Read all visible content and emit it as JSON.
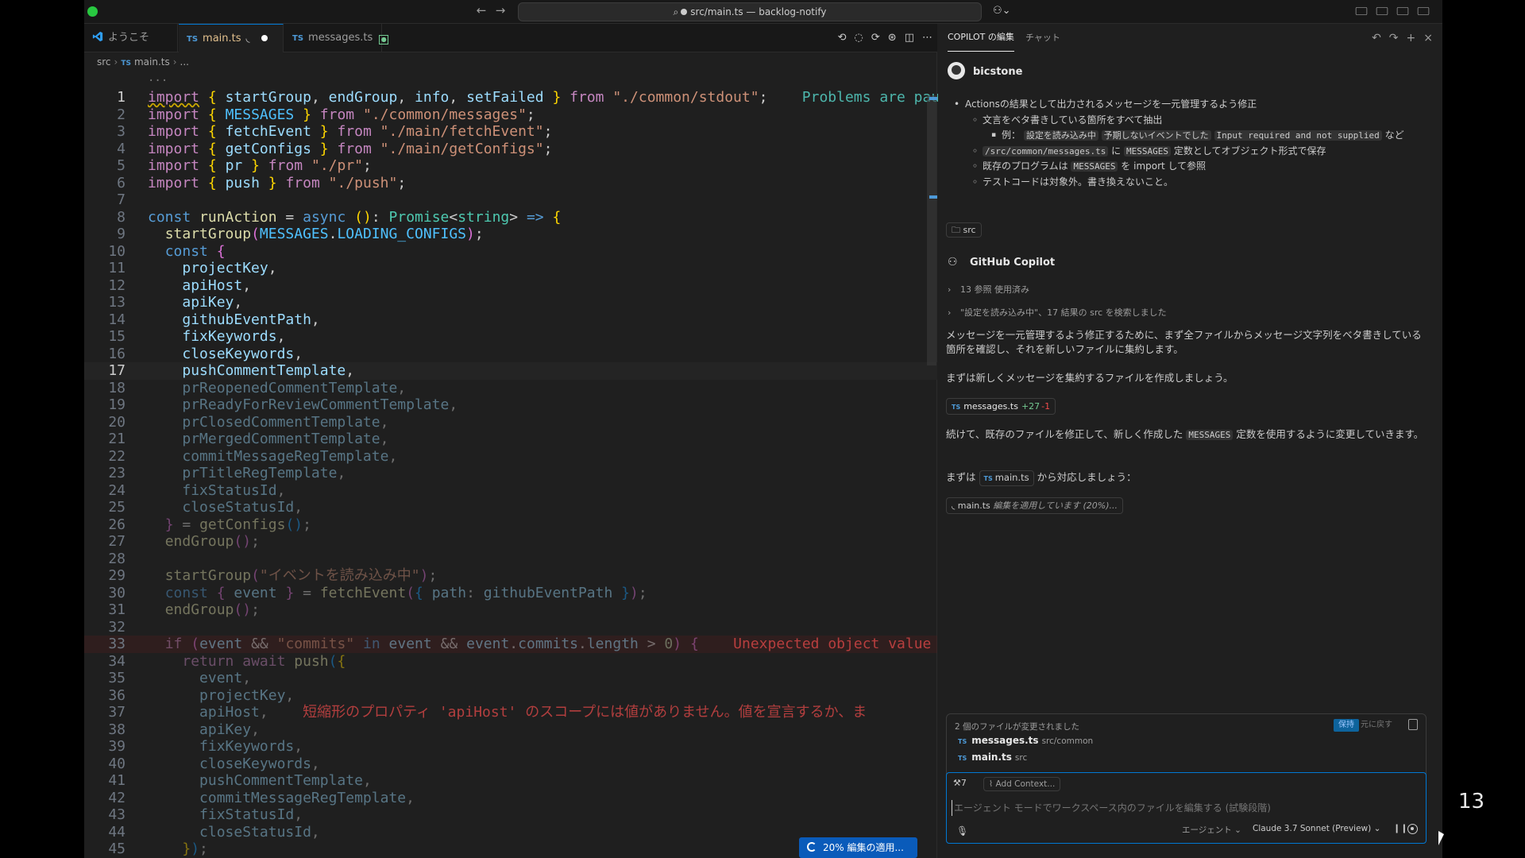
{
  "titlebar": {
    "back": "←",
    "forward": "→",
    "search_icon": "⌕",
    "command_center": "src/main.ts — backlog-notify"
  },
  "editor": {
    "tabs": [
      {
        "label": "ようこそ",
        "icon": "vscode-logo"
      },
      {
        "label": "main.ts",
        "icon": "TS",
        "modified": true,
        "syncing": true
      },
      {
        "label": "messages.ts",
        "icon": "TS",
        "new_marker": "●"
      }
    ],
    "breadcrumb": {
      "folder": "src",
      "file": "main.ts",
      "rest": "..."
    },
    "top_ellipsis": "...",
    "lines": [
      {
        "n": "1",
        "cls": "cur1"
      },
      {
        "n": "2"
      },
      {
        "n": "3"
      },
      {
        "n": "4"
      },
      {
        "n": "5"
      },
      {
        "n": "6"
      },
      {
        "n": "7"
      },
      {
        "n": "8"
      },
      {
        "n": "9"
      },
      {
        "n": "10"
      },
      {
        "n": "11"
      },
      {
        "n": "12"
      },
      {
        "n": "13"
      },
      {
        "n": "14"
      },
      {
        "n": "15"
      },
      {
        "n": "16"
      },
      {
        "n": "17",
        "cls": "current"
      },
      {
        "n": "18"
      },
      {
        "n": "19"
      },
      {
        "n": "20"
      },
      {
        "n": "21"
      },
      {
        "n": "22"
      },
      {
        "n": "23"
      },
      {
        "n": "24"
      },
      {
        "n": "25"
      },
      {
        "n": "26"
      },
      {
        "n": "27"
      },
      {
        "n": "28"
      },
      {
        "n": "29"
      },
      {
        "n": "30"
      },
      {
        "n": "31"
      },
      {
        "n": "32"
      },
      {
        "n": "33",
        "cls": "errline"
      },
      {
        "n": "34"
      },
      {
        "n": "35"
      },
      {
        "n": "36"
      },
      {
        "n": "37"
      },
      {
        "n": "38"
      },
      {
        "n": "39"
      },
      {
        "n": "40"
      },
      {
        "n": "41"
      },
      {
        "n": "42"
      },
      {
        "n": "43"
      },
      {
        "n": "44"
      },
      {
        "n": "45"
      }
    ],
    "inline_problems_paused": "Problems are paused",
    "inline_unexpected": "Unexpected object value in",
    "inline_apihost_error": "短縮形のプロパティ 'apiHost' のスコープには値がありません。値を宣言するか、ま",
    "progress_button": "20% 編集の適用..."
  },
  "panel": {
    "tab_edits": "COPILOT の編集",
    "tab_chat": "チャット",
    "user": "bicstone",
    "request": {
      "b1": "Actionsの結果として出力されるメッセージを一元管理するよう修正",
      "b2": "文言をベタ書きしている箇所をすべて抽出",
      "b3_prefix": "例：",
      "b3_c1": "設定を読み込み中",
      "b3_c2": "予期しないイベントでした",
      "b3_c3": "Input required and not supplied",
      "b3_suffix": "など",
      "b4_c1": "/src/common/messages.ts",
      "b4_mid": "に",
      "b4_c2": "MESSAGES",
      "b4_suffix": "定数としてオブジェクト形式で保存",
      "b5_prefix": "既存のプログラムは",
      "b5_c1": "MESSAGES",
      "b5_suffix": "を import して参照",
      "b6": "テストコードは対象外。書き換えないこと。"
    },
    "src_chip": "src",
    "assistant": "GitHub Copilot",
    "refs_used": "13 参照 使用済み",
    "search_note": "\"設定を読み込み中\"、17 結果の src を検索しました",
    "para1": "メッセージを一元管理するよう修正するために、まず全ファイルからメッセージ文字列をベタ書きしている箇所を確認し、それを新しいファイルに集約します。",
    "para2": "まずは新しくメッセージを集約するファイルを作成しましょう。",
    "file_chip": {
      "name": "messages.ts",
      "added": "+27",
      "removed": "-1"
    },
    "para3_prefix": "続けて、既存のファイルを修正して、新しく作成した",
    "para3_code": "MESSAGES",
    "para3_suffix": "定数を使用するように変更していきます。",
    "para4_prefix": "まずは",
    "para4_file": "main.ts",
    "para4_suffix": "から対応しましょう：",
    "applying_file": "main.ts",
    "applying_status": "編集を適用しています (20%)...",
    "changes": {
      "title": "2 個のファイルが変更されました",
      "keep": "保持",
      "undo": "元に戻す",
      "files": [
        {
          "name": "messages.ts",
          "path": "src/common"
        },
        {
          "name": "main.ts",
          "path": "src"
        }
      ]
    },
    "input": {
      "tools_count": "7",
      "add_context": "Add Context...",
      "placeholder": "エージェント モードでワークスペース内のファイルを編集する (試験段階)",
      "mode": "エージェント",
      "model": "Claude 3.7 Sonnet (Preview)"
    }
  },
  "slide_number": "13"
}
